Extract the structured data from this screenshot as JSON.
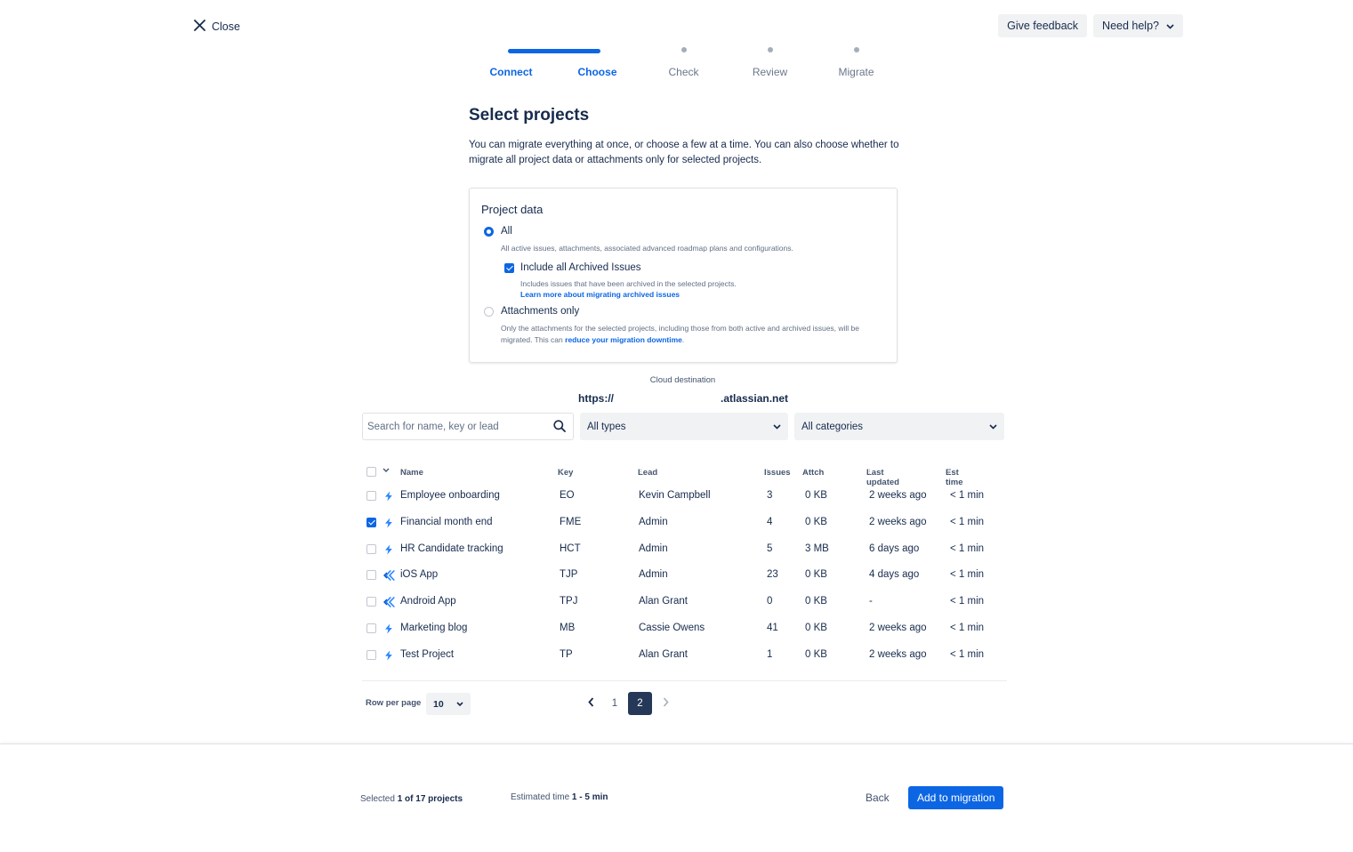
{
  "header": {
    "close_label": "Close",
    "give_feedback_label": "Give feedback",
    "need_help_label": "Need help?"
  },
  "stepper": {
    "steps": [
      {
        "label": "Connect",
        "status": "done"
      },
      {
        "label": "Choose",
        "status": "current"
      },
      {
        "label": "Check",
        "status": "pending"
      },
      {
        "label": "Review",
        "status": "pending"
      },
      {
        "label": "Migrate",
        "status": "pending"
      }
    ]
  },
  "main": {
    "title": "Select projects",
    "description": "You can migrate everything at once, or choose a few at a time. You can also choose whether to migrate all project data or attachments only for selected projects."
  },
  "project_data": {
    "title": "Project data",
    "all_label": "All",
    "all_help": "All active issues, attachments, associated advanced roadmap plans and configurations.",
    "archived_label": "Include all Archived Issues",
    "archived_checked": true,
    "archived_help": "Includes issues that have been archived in the selected projects.",
    "archived_link": "Learn more about migrating archived issues",
    "attachments_label": "Attachments only",
    "attachments_help_1": "Only the attachments for the selected projects, including those from both active and archived issues, will be migrated. This can",
    "attachments_link": "reduce your migration downtime",
    "attachments_help_2": ".",
    "selected": "all"
  },
  "destination": {
    "label": "Cloud destination",
    "url_prefix": "https://",
    "url_suffix": ".atlassian.net"
  },
  "filters": {
    "search_placeholder": "Search for name, key or lead",
    "types_value": "All types",
    "categories_value": "All categories"
  },
  "table": {
    "columns": [
      "Name",
      "Key",
      "Lead",
      "Issues",
      "Attch",
      "Last updated",
      "Est time"
    ],
    "rows": [
      {
        "name": "Employee onboarding",
        "key": "EO",
        "lead": "Kevin Campbell",
        "issues": "3",
        "attch": "0 KB",
        "updated": "2 weeks ago",
        "est": "< 1 min",
        "checked": false,
        "icon": "lightning-icon"
      },
      {
        "name": "Financial month end",
        "key": "FME",
        "lead": "Admin",
        "issues": "4",
        "attch": "0 KB",
        "updated": "2 weeks ago",
        "est": "< 1 min",
        "checked": true,
        "icon": "lightning-icon"
      },
      {
        "name": "HR Candidate tracking",
        "key": "HCT",
        "lead": "Admin",
        "issues": "5",
        "attch": "3 MB",
        "updated": "6 days ago",
        "est": "< 1 min",
        "checked": false,
        "icon": "lightning-icon"
      },
      {
        "name": "iOS App",
        "key": "TJP",
        "lead": "Admin",
        "issues": "23",
        "attch": "0 KB",
        "updated": "4 days ago",
        "est": "< 1 min",
        "checked": false,
        "icon": "software-icon"
      },
      {
        "name": "Android App",
        "key": "TPJ",
        "lead": "Alan Grant",
        "issues": "0",
        "attch": "0 KB",
        "updated": "-",
        "est": "< 1 min",
        "checked": false,
        "icon": "software-icon"
      },
      {
        "name": "Marketing blog",
        "key": "MB",
        "lead": "Cassie Owens",
        "issues": "41",
        "attch": "0 KB",
        "updated": "2 weeks ago",
        "est": "< 1 min",
        "checked": false,
        "icon": "lightning-icon"
      },
      {
        "name": "Test Project",
        "key": "TP",
        "lead": "Alan Grant",
        "issues": "1",
        "attch": "0 KB",
        "updated": "2 weeks ago",
        "est": "< 1 min",
        "checked": false,
        "icon": "lightning-icon"
      }
    ]
  },
  "pagination": {
    "rows_per_page_label": "Row per page",
    "rows_per_page_value": "10",
    "pages": [
      "1",
      "2"
    ],
    "current_page": "2"
  },
  "footer": {
    "selected_prefix": "Selected",
    "selected_value": "1 of 17 projects",
    "estimated_prefix": "Estimated time",
    "estimated_value": "1 - 5 min",
    "back_label": "Back",
    "add_label": "Add to migration"
  },
  "colors": {
    "brand": "#0C66E4",
    "text": "#172B4D",
    "subtle": "#44546F",
    "active_page": "#253858"
  }
}
